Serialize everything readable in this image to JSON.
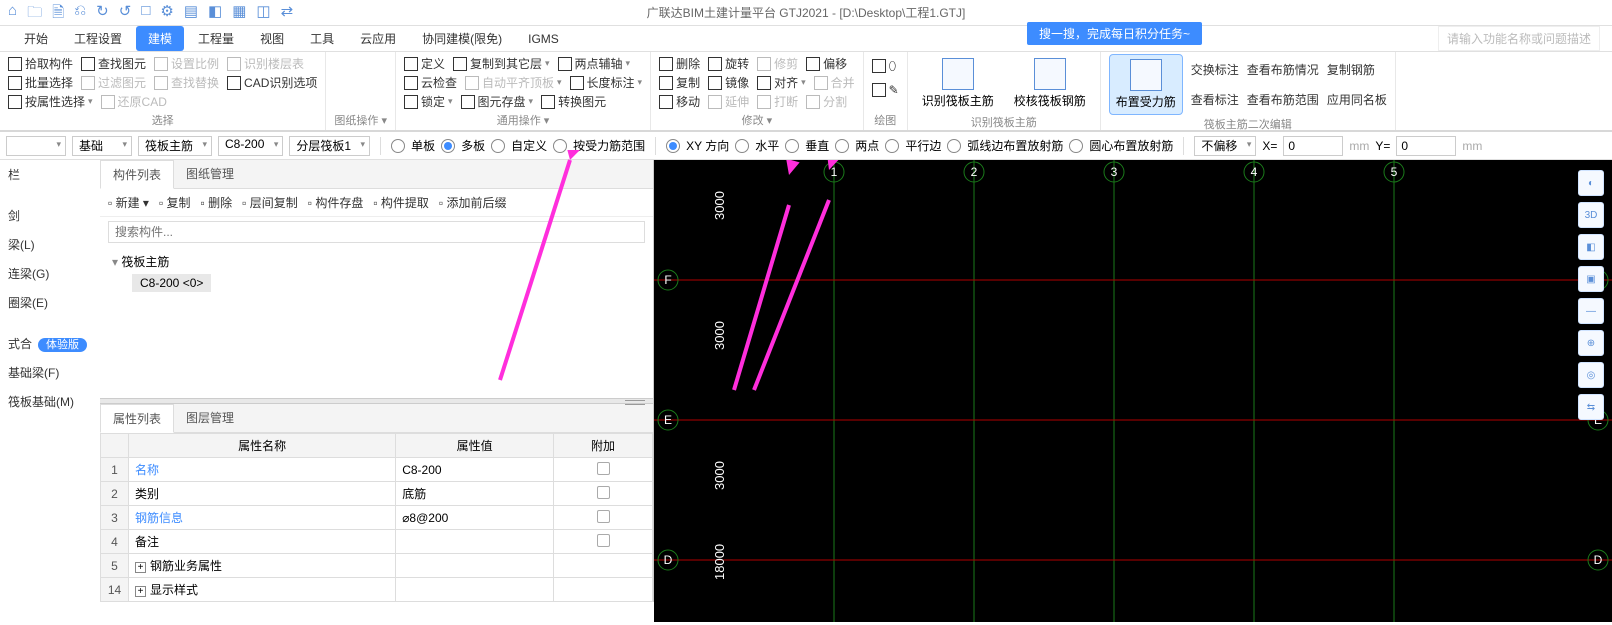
{
  "app": {
    "title": "广联达BIM土建计量平台 GTJ2021 - [D:\\Desktop\\工程1.GTJ]",
    "notice": "搜一搜，完成每日积分任务~",
    "search_placeholder": "请输入功能名称或问题描述"
  },
  "qat": [
    "⌂",
    "🗀",
    "🗎",
    "⎌",
    "↻",
    "↺",
    "□",
    "⚙",
    "▤",
    "◧",
    "▦",
    "◫",
    "⇄"
  ],
  "tabs": {
    "items": [
      "开始",
      "工程设置",
      "建模",
      "工程量",
      "视图",
      "工具",
      "云应用",
      "协同建模(限免)",
      "IGMS"
    ],
    "active_index": 2
  },
  "ribbon": {
    "groups": [
      {
        "label": "选择",
        "rows": [
          [
            {
              "t": "拾取构件"
            },
            {
              "t": "查找图元"
            },
            {
              "t": "设置比例",
              "dim": true
            },
            {
              "t": "识别楼层表",
              "dim": true
            }
          ],
          [
            {
              "t": "批量选择"
            },
            {
              "t": "过滤图元",
              "dim": true
            },
            {
              "t": "查找替换",
              "dim": true
            },
            {
              "t": "CAD识别选项"
            }
          ],
          [
            {
              "t": "按属性选择",
              "drop": true
            },
            {
              "t": "还原CAD",
              "dim": true
            }
          ]
        ]
      },
      {
        "label": "图纸操作 ▾",
        "rows": [
          [],
          [],
          []
        ]
      },
      {
        "label": "通用操作 ▾",
        "rows": [
          [
            {
              "t": "定义"
            },
            {
              "t": "复制到其它层",
              "drop": true
            },
            {
              "t": "两点辅轴",
              "drop": true
            }
          ],
          [
            {
              "t": "云检查"
            },
            {
              "t": "自动平齐顶板",
              "drop": true,
              "dim": true
            },
            {
              "t": "长度标注",
              "drop": true
            }
          ],
          [
            {
              "t": "锁定",
              "drop": true
            },
            {
              "t": "图元存盘",
              "drop": true
            },
            {
              "t": "转换图元"
            }
          ]
        ]
      },
      {
        "label": "修改 ▾",
        "rows": [
          [
            {
              "t": "删除"
            },
            {
              "t": "旋转"
            },
            {
              "t": "修剪",
              "dim": true
            },
            {
              "t": "偏移"
            }
          ],
          [
            {
              "t": "复制"
            },
            {
              "t": "镜像"
            },
            {
              "t": "对齐",
              "drop": true
            },
            {
              "t": "合并",
              "dim": true
            }
          ],
          [
            {
              "t": "移动"
            },
            {
              "t": "延伸",
              "dim": true
            },
            {
              "t": "打断",
              "dim": true
            },
            {
              "t": "分割",
              "dim": true
            }
          ]
        ]
      },
      {
        "label": "绘图",
        "rows": [
          [
            {
              "t": "⬯"
            }
          ],
          [
            {
              "t": "✎"
            }
          ],
          []
        ]
      },
      {
        "label": "识别筏板主筋",
        "big": [
          {
            "t": "识别筏板主筋"
          },
          {
            "t": "校核筏板钢筋"
          }
        ]
      },
      {
        "label": "筏板主筋二次编辑",
        "big_active": {
          "t": "布置受力筋"
        },
        "rows": [
          [
            {
              "t": "交换标注"
            },
            {
              "t": "查看布筋情况"
            },
            {
              "t": "复制钢筋"
            }
          ],
          [
            {
              "t": "查看标注"
            },
            {
              "t": "查看布筋范围"
            },
            {
              "t": "应用同名板"
            }
          ]
        ]
      }
    ]
  },
  "options": {
    "combos": [
      "",
      "基础",
      "筏板主筋",
      "C8-200",
      "分层筏板1"
    ],
    "radios1": [
      {
        "label": "单板",
        "sel": false
      },
      {
        "label": "多板",
        "sel": true
      },
      {
        "label": "自定义",
        "sel": false
      },
      {
        "label": "按受力筋范围",
        "sel": false
      }
    ],
    "radios2": [
      {
        "label": "XY 方向",
        "sel": true
      },
      {
        "label": "水平",
        "sel": false
      },
      {
        "label": "垂直",
        "sel": false
      },
      {
        "label": "两点",
        "sel": false
      },
      {
        "label": "平行边",
        "sel": false
      },
      {
        "label": "弧线边布置放射筋",
        "sel": false
      },
      {
        "label": "圆心布置放射筋",
        "sel": false
      }
    ],
    "offset_label": "不偏移",
    "x_label": "X=",
    "x_val": "0",
    "x_unit": "mm",
    "y_label": "Y=",
    "y_val": "0",
    "y_unit": "mm"
  },
  "nav": {
    "items": [
      "栏",
      "",
      "剑",
      "梁(L)",
      "连梁(G)",
      "圈梁(E)",
      "",
      "式合",
      "基础梁(F)",
      "筏板基础(M)"
    ],
    "badge": "体验版"
  },
  "component_panel": {
    "tabs": [
      "构件列表",
      "图纸管理"
    ],
    "active_tab": 0,
    "toolbar": [
      "新建 ▾",
      "复制",
      "删除",
      "层间复制",
      "构件存盘",
      "构件提取",
      "添加前后缀"
    ],
    "search_placeholder": "搜索构件...",
    "tree_parent": "筏板主筋",
    "tree_child": "C8-200  <0>"
  },
  "property_panel": {
    "tabs": [
      "属性列表",
      "图层管理"
    ],
    "active_tab": 0,
    "headers": [
      "",
      "属性名称",
      "属性值",
      "附加"
    ],
    "rows": [
      {
        "n": "1",
        "name": "名称",
        "link": true,
        "val": "C8-200",
        "chk": false
      },
      {
        "n": "2",
        "name": "类别",
        "link": false,
        "val": "底筋",
        "chk": true
      },
      {
        "n": "3",
        "name": "钢筋信息",
        "link": true,
        "val": "⌀8@200",
        "chk": true
      },
      {
        "n": "4",
        "name": "备注",
        "link": false,
        "val": "",
        "chk": true
      },
      {
        "n": "5",
        "name": "钢筋业务属性",
        "link": false,
        "val": "",
        "plus": true
      },
      {
        "n": "14",
        "name": "显示样式",
        "link": false,
        "val": "",
        "plus": true
      }
    ]
  },
  "canvas": {
    "col_bubbles": [
      "1",
      "2",
      "3",
      "4",
      "5"
    ],
    "row_bubbles": [
      "F",
      "E",
      "D"
    ],
    "dims": [
      "3000",
      "3000",
      "3000",
      "18000"
    ]
  },
  "view_tools": [
    "◐",
    "3D",
    "◧",
    "▣",
    "—",
    "⊕",
    "◎",
    "⇆"
  ]
}
